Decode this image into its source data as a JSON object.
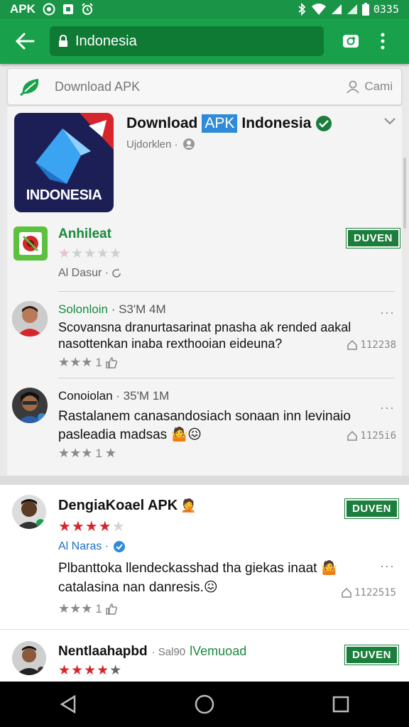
{
  "status_bar": {
    "carrier": "APK",
    "time": "0335",
    "icons": [
      "target-icon",
      "photo-icon",
      "alarm-icon",
      "bluetooth-icon",
      "wifi-icon",
      "signal-icon",
      "signal-icon",
      "battery-icon"
    ]
  },
  "app_bar": {
    "url": "Indonesia",
    "icons": [
      "back-arrow-icon",
      "lock-icon",
      "tab-switch-icon",
      "more-vertical-icon"
    ]
  },
  "search": {
    "placeholder": "Download APK",
    "camera_label": "Cami"
  },
  "app": {
    "title_prefix": "Download",
    "title_tag": "APK",
    "title_suffix": "Indonesia",
    "subtitle": "Ujdorklen ·",
    "icon_label": "INDONESIA"
  },
  "related": {
    "name": "Anhileat",
    "rating": 1,
    "developer": "Al Dasur ·",
    "button": "DUVEN"
  },
  "reviews": [
    {
      "name": "Solonloin",
      "meta": "· S3'M 4M",
      "text_line1": "Scovansna dranurtasarinat pnasha ak rended aakal",
      "text_line2": "nasottenkan inaba rexthooian eideuna?",
      "rating_count": "1",
      "likes": "112238",
      "more": "···"
    },
    {
      "name": "Conoiolan",
      "meta": "· 35'M 1M",
      "text_line1": "Rastalanem canasandosiach sonaan inn levinaio",
      "text_line2": "pasleadia madsas",
      "rating_count": "1",
      "likes": "1125i6",
      "more": "···"
    }
  ],
  "lower_items": [
    {
      "title": "DengiaKoael APK",
      "rating": 4,
      "developer": "Al Naras ·",
      "button": "DUVEN",
      "text_line1": "Plbanttoka llendeckasshad tha giekas inaat",
      "text_line2": "catalasina nan danresis.",
      "rating_count": "1",
      "likes": "1122515",
      "more": "···"
    },
    {
      "title": "Nentlaahapbd",
      "meta": "· Sal90",
      "link": "lVemuoad",
      "rating": 4,
      "button": "DUVEN"
    }
  ],
  "colors": {
    "brand_green": "#18a14a",
    "button_green": "#1b7e3c",
    "star_red": "#d6252b",
    "tag_blue": "#2f8bd9"
  }
}
